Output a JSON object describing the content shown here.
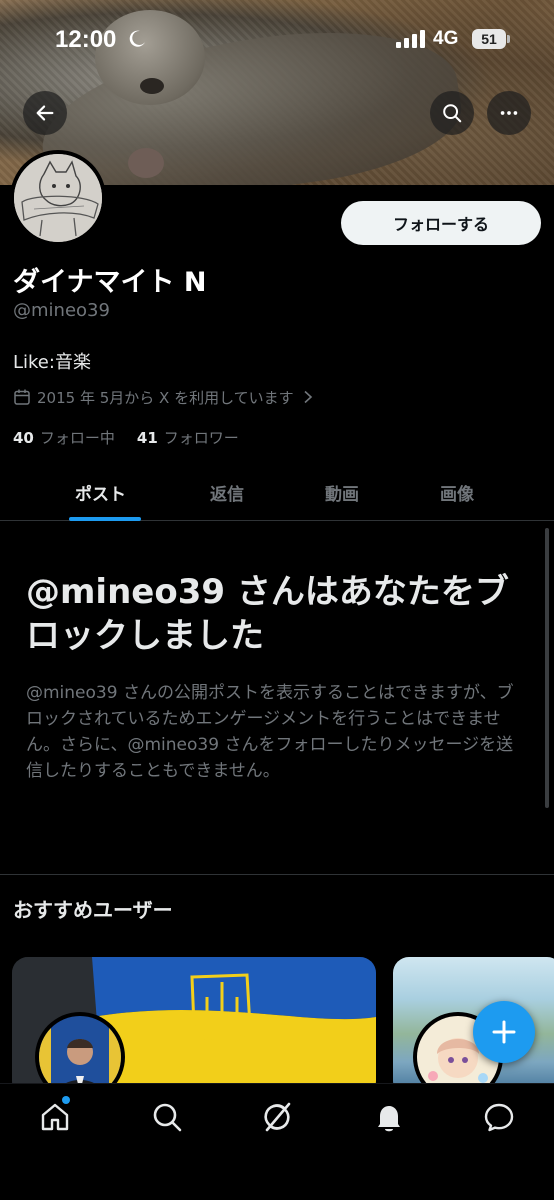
{
  "status_bar": {
    "time": "12:00",
    "network": "4G",
    "battery": "51"
  },
  "header": {
    "back_icon": "arrow-left-icon",
    "search_icon": "search-icon",
    "more_icon": "more-horizontal-icon"
  },
  "profile": {
    "follow_label": "フォローする",
    "name": "ダイナマイト N",
    "handle": "@mineo39",
    "bio": "Like:音楽",
    "joined": "2015 年 5月から X を利用しています",
    "following_count": "40",
    "following_label": "フォロー中",
    "followers_count": "41",
    "followers_label": "フォロワー"
  },
  "tabs": [
    {
      "label": "ポスト",
      "active": true
    },
    {
      "label": "返信",
      "active": false
    },
    {
      "label": "動画",
      "active": false
    },
    {
      "label": "画像",
      "active": false
    }
  ],
  "blocked": {
    "title": "@mineo39 さんはあなたをブロックしました",
    "body": "@mineo39 さんの公開ポストを表示することはできますが、ブロックされているためエンゲージメントを行うことはできません。さらに、@mineo39 さんをフォローしたりメッセージを送信したりすることもできません。"
  },
  "suggestions": {
    "title": "おすすめユーザー"
  },
  "colors": {
    "accent": "#1d9bf0",
    "background": "#000000",
    "muted_text": "#71767b",
    "primary_text": "#e7e9ea"
  },
  "bottom_nav": [
    {
      "icon": "home-icon",
      "active": true
    },
    {
      "icon": "search-icon",
      "active": false
    },
    {
      "icon": "grok-icon",
      "active": false
    },
    {
      "icon": "bell-icon",
      "active": false
    },
    {
      "icon": "message-icon",
      "active": false
    }
  ]
}
